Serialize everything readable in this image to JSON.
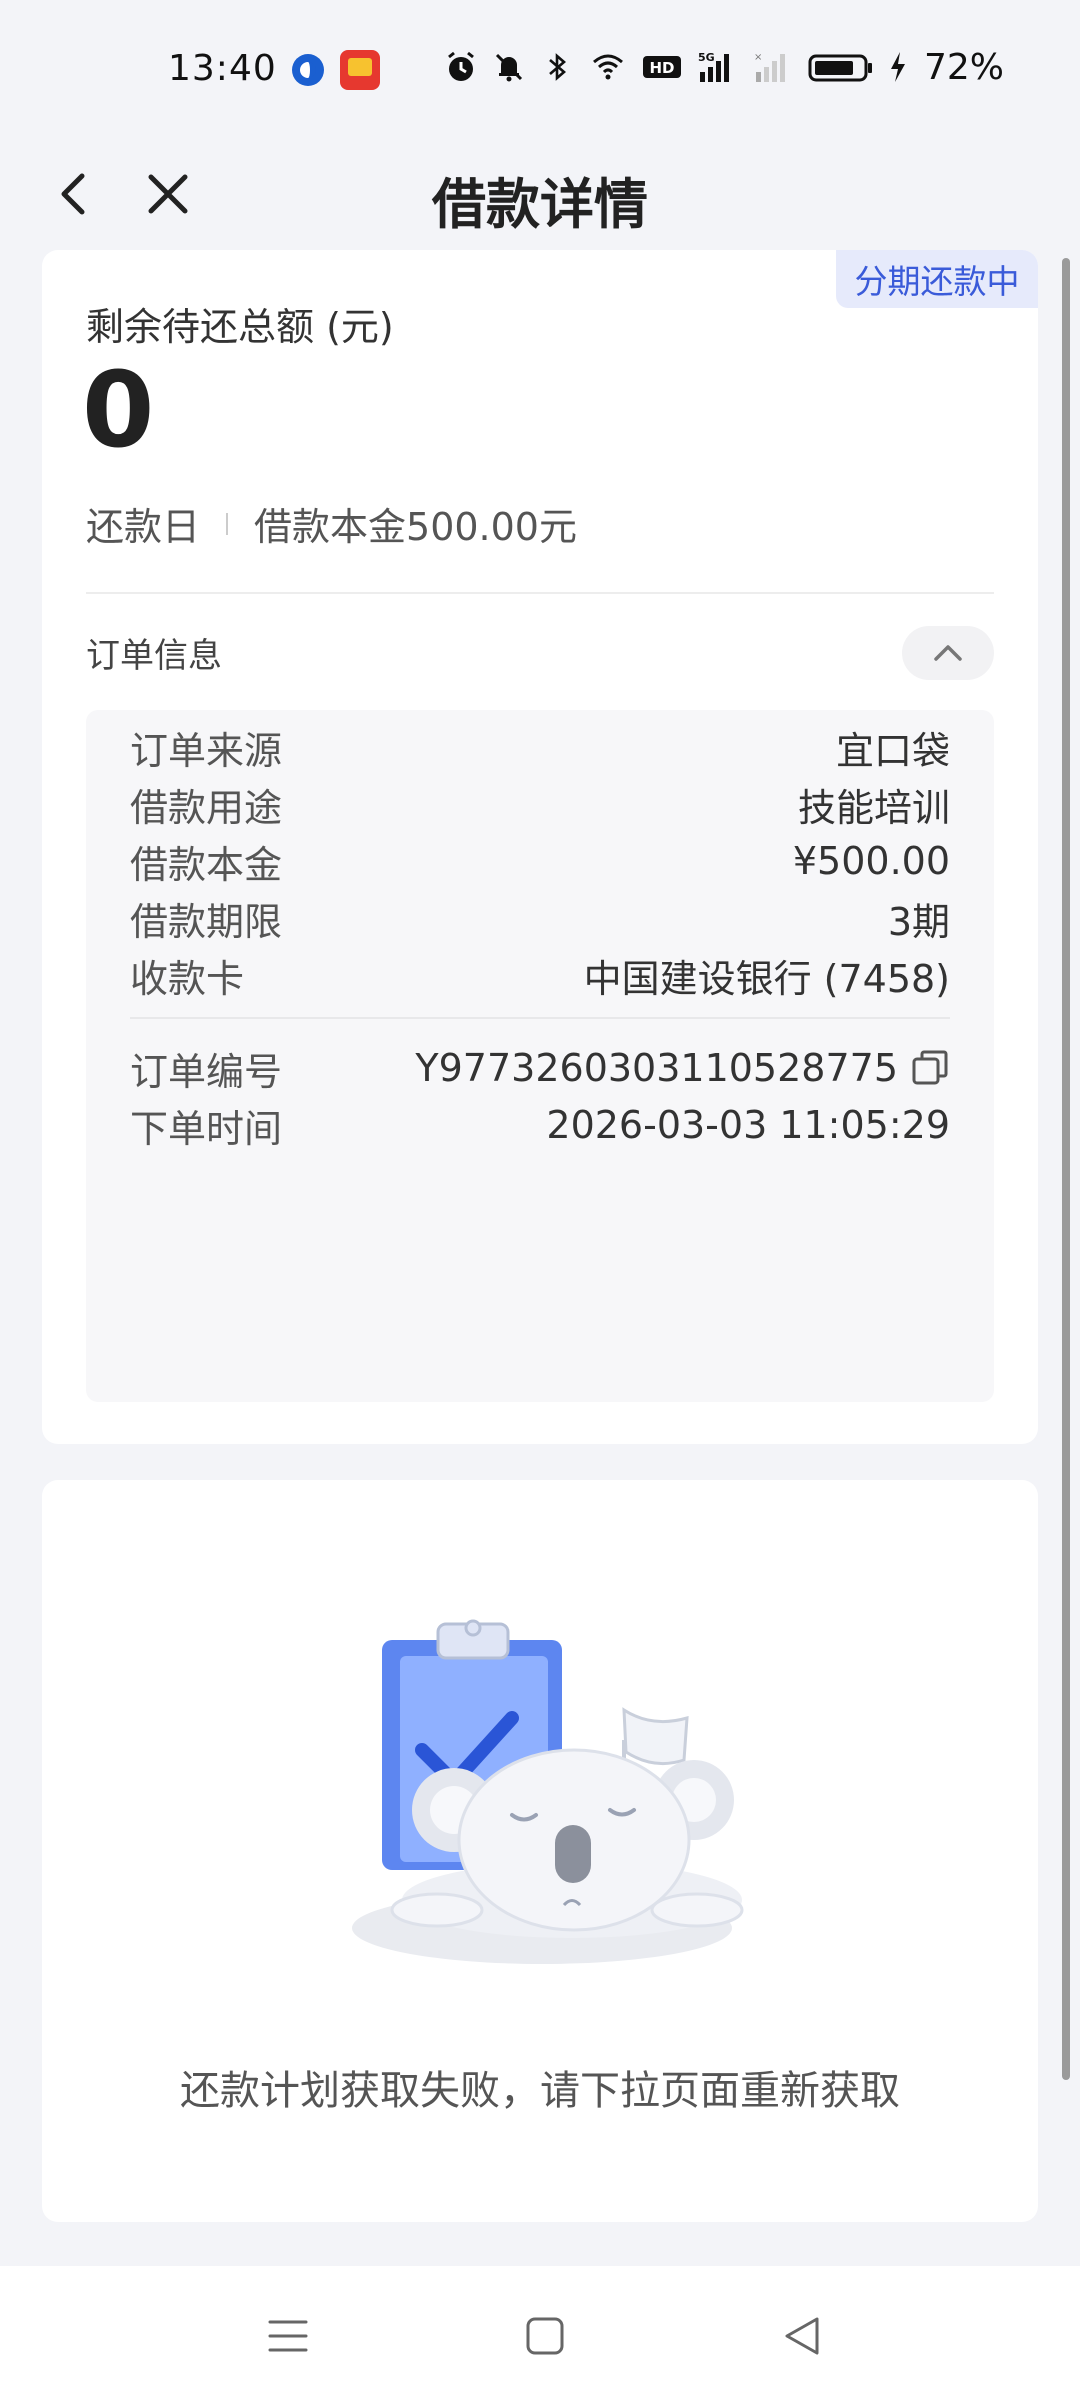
{
  "status_bar": {
    "time": "13:40",
    "battery": "72%",
    "icons": [
      "app-c-icon",
      "app-red-icon",
      "alarm-icon",
      "mute-icon",
      "bluetooth-icon",
      "wifi-icon",
      "hd-icon",
      "signal-5g-icon",
      "signal-icon",
      "battery-icon",
      "charging-icon"
    ]
  },
  "header": {
    "title": "借款详情",
    "back_icon": "chevron-left-icon",
    "close_icon": "close-icon"
  },
  "loan": {
    "status_badge": "分期还款中",
    "remaining_label": "剩余待还总额 (元)",
    "remaining_amount": "0",
    "repay_day_label": "还款日",
    "principal_summary": "借款本金500.00元"
  },
  "order_info": {
    "title": "订单信息",
    "toggle_icon": "chevron-up-icon",
    "rows": [
      {
        "label": "订单来源",
        "value": "宜口袋"
      },
      {
        "label": "借款用途",
        "value": "技能培训"
      },
      {
        "label": "借款本金",
        "value": "¥500.00"
      },
      {
        "label": "借款期限",
        "value": "3期"
      },
      {
        "label": "收款卡",
        "value": "中国建设银行 (7458)"
      }
    ],
    "order_no_label": "订单编号",
    "order_no_value": "Y977326030311052877​5",
    "order_time_label": "下单时间",
    "order_time_value": "2026-03-03 11:05:29"
  },
  "repay_plan": {
    "illustration": "sleeping-koala-clipboard-illustration",
    "message": "还款计划获取失败，请下拉页面重新获取"
  },
  "nav_bar": {
    "icons": [
      "menu-icon",
      "home-square-icon",
      "back-triangle-icon"
    ]
  },
  "colors": {
    "accent": "#3a5bd9",
    "badge_bg": "#e6eafb",
    "page_bg": "#f3f4f8"
  }
}
